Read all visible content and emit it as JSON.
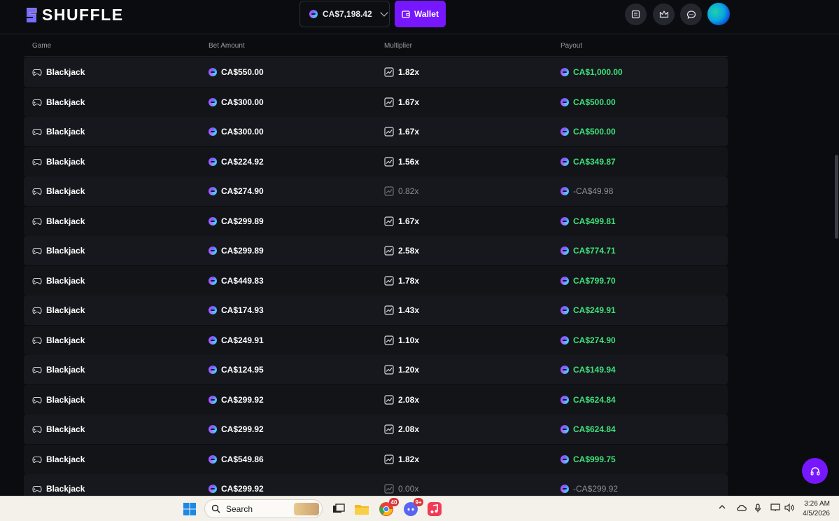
{
  "header": {
    "logo_text": "SHUFFLE",
    "balance": "CA$7,198.42",
    "wallet_label": "Wallet",
    "brand_color": "#7717ff"
  },
  "table": {
    "columns": [
      "Game",
      "Bet Amount",
      "Multiplier",
      "Payout"
    ],
    "rows": [
      {
        "game": "Blackjack",
        "bet": "CA$550.00",
        "multiplier": "1.82x",
        "payout": "CA$1,000.00",
        "win": true
      },
      {
        "game": "Blackjack",
        "bet": "CA$300.00",
        "multiplier": "1.67x",
        "payout": "CA$500.00",
        "win": true
      },
      {
        "game": "Blackjack",
        "bet": "CA$300.00",
        "multiplier": "1.67x",
        "payout": "CA$500.00",
        "win": true
      },
      {
        "game": "Blackjack",
        "bet": "CA$224.92",
        "multiplier": "1.56x",
        "payout": "CA$349.87",
        "win": true
      },
      {
        "game": "Blackjack",
        "bet": "CA$274.90",
        "multiplier": "0.82x",
        "payout": "-CA$49.98",
        "win": false
      },
      {
        "game": "Blackjack",
        "bet": "CA$299.89",
        "multiplier": "1.67x",
        "payout": "CA$499.81",
        "win": true
      },
      {
        "game": "Blackjack",
        "bet": "CA$299.89",
        "multiplier": "2.58x",
        "payout": "CA$774.71",
        "win": true
      },
      {
        "game": "Blackjack",
        "bet": "CA$449.83",
        "multiplier": "1.78x",
        "payout": "CA$799.70",
        "win": true
      },
      {
        "game": "Blackjack",
        "bet": "CA$174.93",
        "multiplier": "1.43x",
        "payout": "CA$249.91",
        "win": true
      },
      {
        "game": "Blackjack",
        "bet": "CA$249.91",
        "multiplier": "1.10x",
        "payout": "CA$274.90",
        "win": true
      },
      {
        "game": "Blackjack",
        "bet": "CA$124.95",
        "multiplier": "1.20x",
        "payout": "CA$149.94",
        "win": true
      },
      {
        "game": "Blackjack",
        "bet": "CA$299.92",
        "multiplier": "2.08x",
        "payout": "CA$624.84",
        "win": true
      },
      {
        "game": "Blackjack",
        "bet": "CA$299.92",
        "multiplier": "2.08x",
        "payout": "CA$624.84",
        "win": true
      },
      {
        "game": "Blackjack",
        "bet": "CA$549.86",
        "multiplier": "1.82x",
        "payout": "CA$999.75",
        "win": true
      },
      {
        "game": "Blackjack",
        "bet": "CA$299.92",
        "multiplier": "0.00x",
        "payout": "-CA$299.92",
        "win": false
      }
    ]
  },
  "taskbar": {
    "search_label": "Search",
    "chrome_badge": "40",
    "discord_badge": "9+",
    "time": "3:26 AM",
    "date": "4/5/2026"
  },
  "icons": {
    "header_buttons": [
      "notes-icon",
      "crown-icon",
      "chat-icon"
    ],
    "support": "headset-icon"
  }
}
